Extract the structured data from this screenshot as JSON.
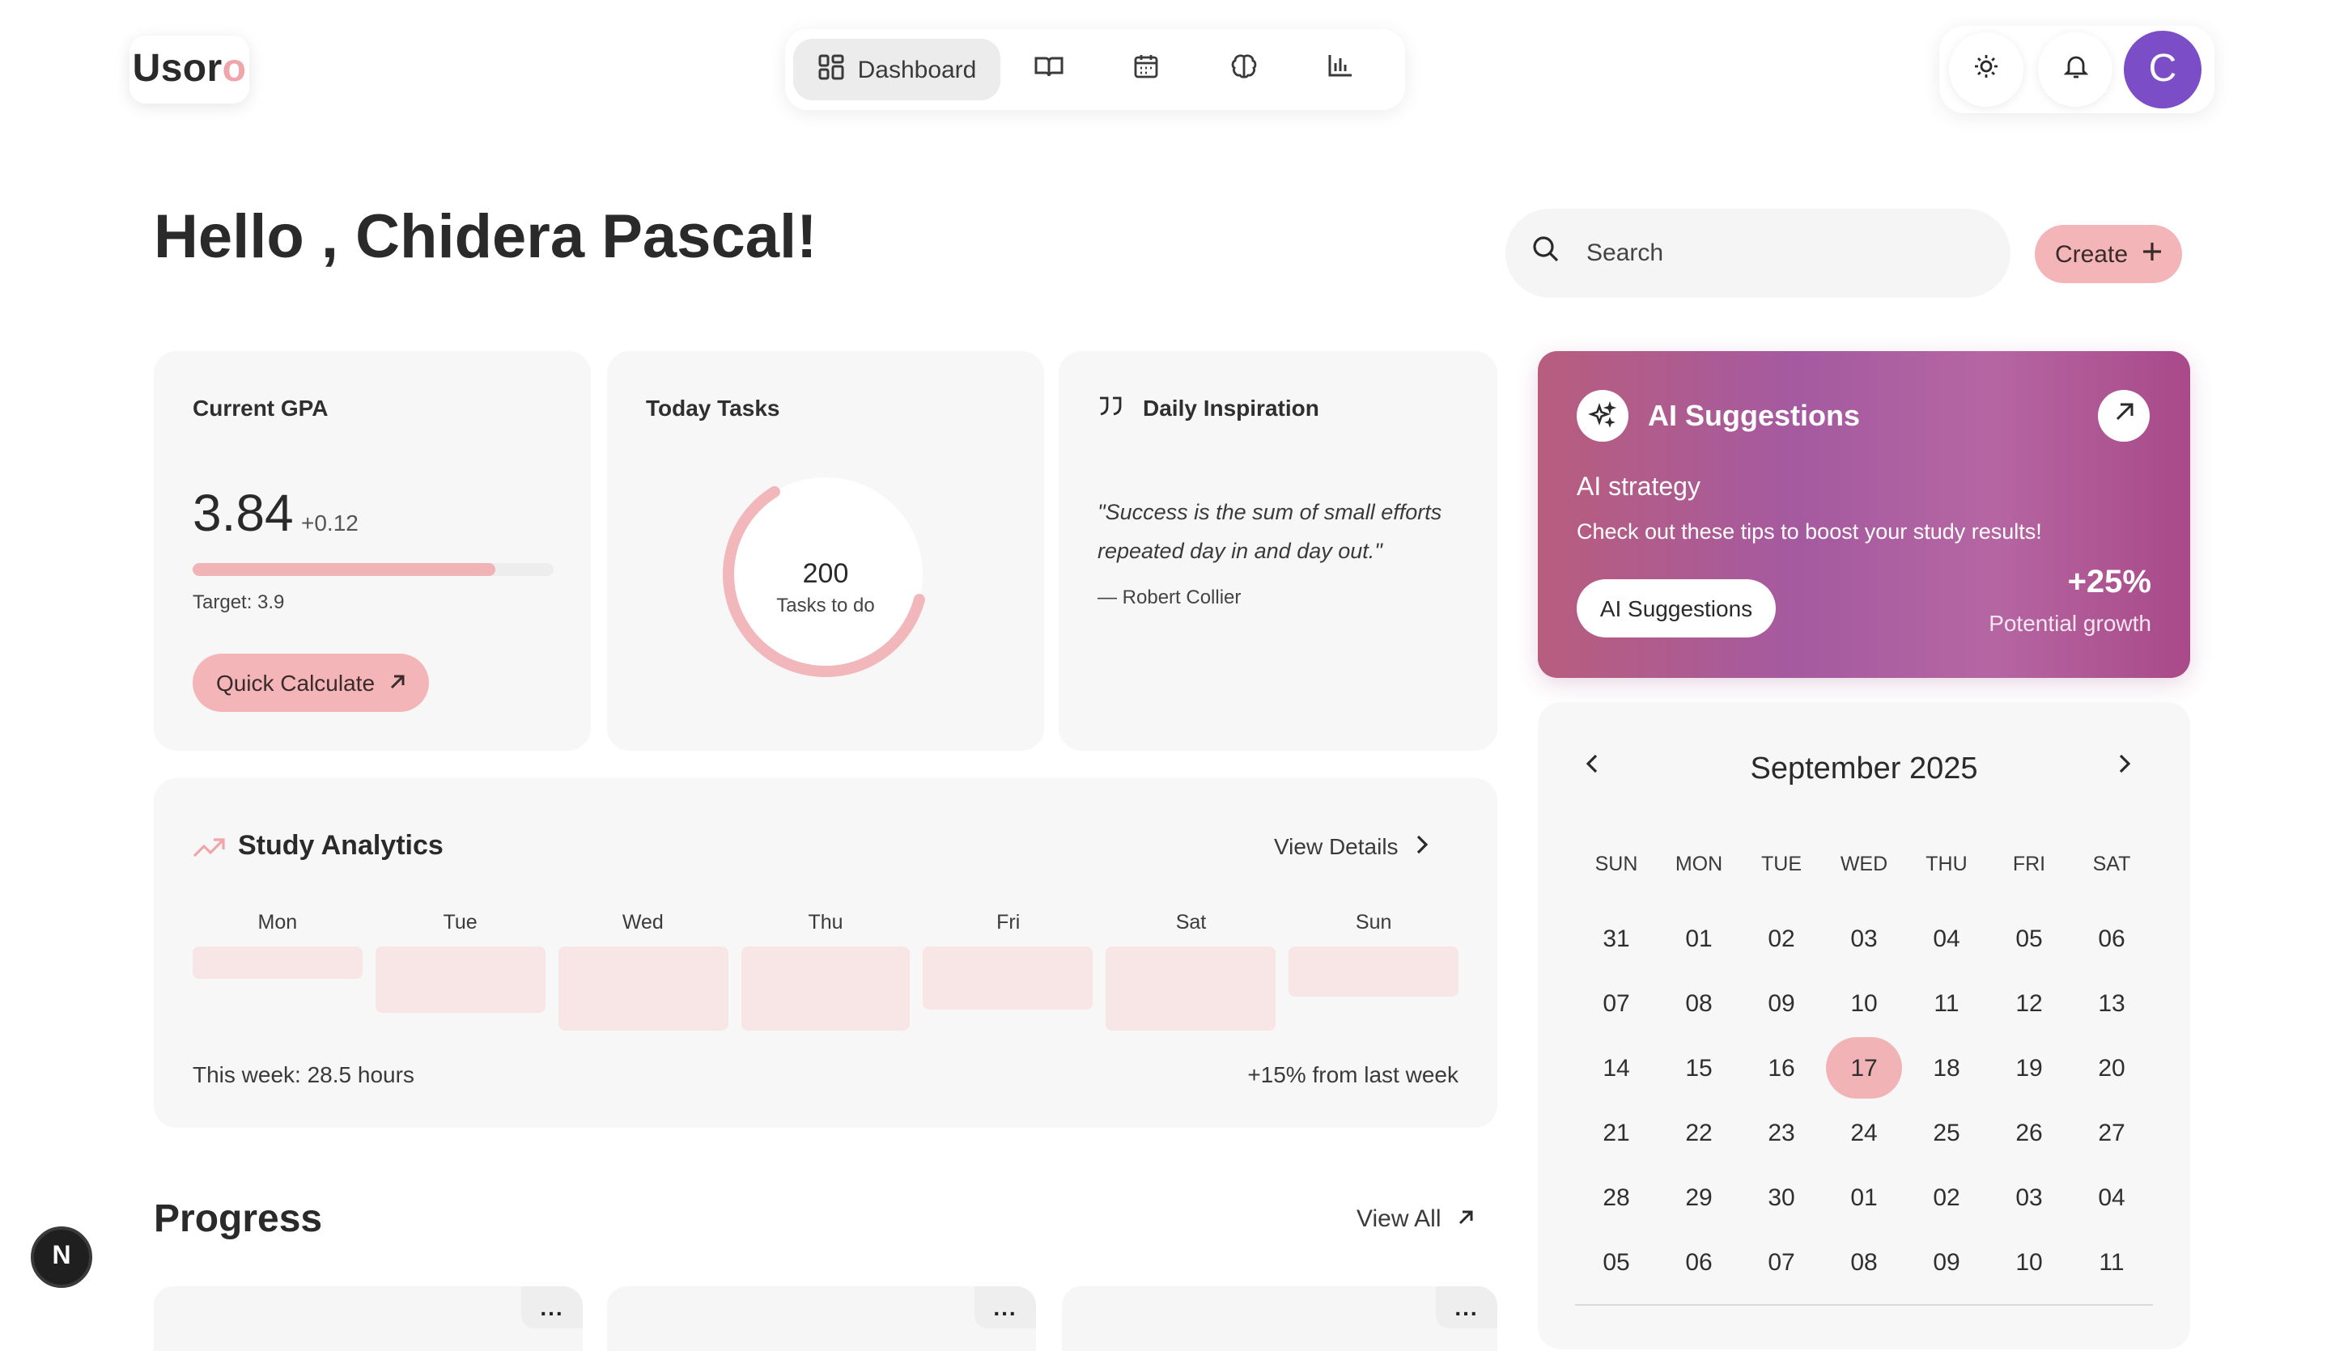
{
  "logo": {
    "main": "Usor",
    "accent": "o"
  },
  "nav": {
    "active_label": "Dashboard",
    "icons": [
      "dashboard-icon",
      "book-icon",
      "calendar-icon",
      "brain-icon",
      "bar-chart-icon"
    ]
  },
  "header_actions": {
    "icons": [
      "sun-icon",
      "bell-icon"
    ],
    "avatar_initial": "C",
    "avatar_color": "#7b4dc6"
  },
  "greeting": "Hello , Chidera Pascal!",
  "search": {
    "placeholder": "Search"
  },
  "create_label": "Create",
  "gpa": {
    "title": "Current GPA",
    "value": "3.84",
    "delta": "+0.12",
    "progress_fraction": 0.84,
    "target": "Target: 3.9",
    "button": "Quick Calculate"
  },
  "tasks": {
    "title": "Today Tasks",
    "count": "200",
    "label": "Tasks to do",
    "ring_fraction": 0.62
  },
  "inspiration": {
    "title": "Daily Inspiration",
    "quote": "\"Success is the sum of small efforts repeated day in and day out.\"",
    "author": "— Robert Collier"
  },
  "ai": {
    "title": "AI Suggestions",
    "subtitle": "AI strategy",
    "description": "Check out these tips to boost your study results!",
    "button": "AI Suggestions",
    "growth": "+25%",
    "growth_label": "Potential growth"
  },
  "analytics": {
    "title": "Study Analytics",
    "view_label": "View Details",
    "days": [
      {
        "label": "Mon",
        "level": 0.38
      },
      {
        "label": "Tue",
        "level": 0.78
      },
      {
        "label": "Wed",
        "level": 1.0
      },
      {
        "label": "Thu",
        "level": 1.0
      },
      {
        "label": "Fri",
        "level": 0.75
      },
      {
        "label": "Sat",
        "level": 1.0
      },
      {
        "label": "Sun",
        "level": 0.6
      }
    ],
    "week_total": "This week: 28.5 hours",
    "change": "+15% from last week"
  },
  "progress": {
    "title": "Progress",
    "view_label": "View All",
    "more_label": "..."
  },
  "calendar": {
    "month": "September 2025",
    "weekdays": [
      "SUN",
      "MON",
      "TUE",
      "WED",
      "THU",
      "FRI",
      "SAT"
    ],
    "days": [
      "31",
      "01",
      "02",
      "03",
      "04",
      "05",
      "06",
      "07",
      "08",
      "09",
      "10",
      "11",
      "12",
      "13",
      "14",
      "15",
      "16",
      "17",
      "18",
      "19",
      "20",
      "21",
      "22",
      "23",
      "24",
      "25",
      "26",
      "27",
      "28",
      "29",
      "30",
      "01",
      "02",
      "03",
      "04",
      "05",
      "06",
      "07",
      "08",
      "09",
      "10",
      "11"
    ],
    "selected": "17"
  },
  "badge": "N"
}
